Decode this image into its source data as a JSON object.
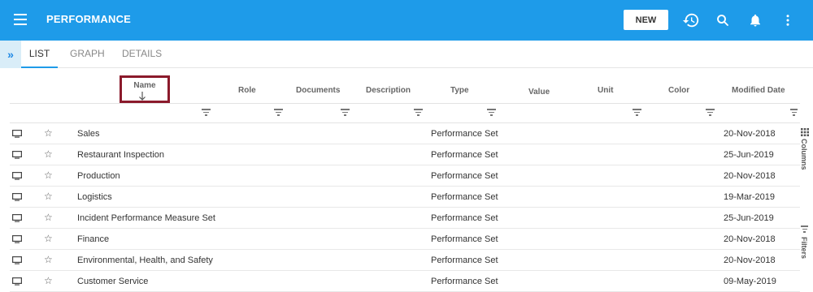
{
  "app": {
    "title": "PERFORMANCE",
    "new_label": "NEW"
  },
  "icons": {
    "menu": "hamburger-icon",
    "history": "history-icon",
    "search": "search-icon",
    "notifications": "bell-icon",
    "more": "more-vertical-icon",
    "expand": "double-chevron-right-icon",
    "row_view": "monitor-icon",
    "favorite": "star-outline-icon",
    "filter": "filter-icon",
    "sort": "arrow-down-icon",
    "columns": "grid-icon"
  },
  "tabs": [
    {
      "label": "LIST",
      "active": true
    },
    {
      "label": "GRAPH",
      "active": false
    },
    {
      "label": "DETAILS",
      "active": false
    }
  ],
  "columns": {
    "name": "Name",
    "role": "Role",
    "documents": "Documents",
    "description": "Description",
    "type": "Type",
    "value": "Value",
    "unit": "Unit",
    "color": "Color",
    "modified": "Modified Date"
  },
  "sort": {
    "column": "Name",
    "direction": "descending"
  },
  "rows": [
    {
      "name": "Sales",
      "type": "Performance Set",
      "modified": "20-Nov-2018"
    },
    {
      "name": "Restaurant Inspection",
      "type": "Performance Set",
      "modified": "25-Jun-2019"
    },
    {
      "name": "Production",
      "type": "Performance Set",
      "modified": "20-Nov-2018"
    },
    {
      "name": "Logistics",
      "type": "Performance Set",
      "modified": "19-Mar-2019"
    },
    {
      "name": "Incident Performance Measure Set",
      "type": "Performance Set",
      "modified": "25-Jun-2019"
    },
    {
      "name": "Finance",
      "type": "Performance Set",
      "modified": "20-Nov-2018"
    },
    {
      "name": "Environmental, Health, and Safety",
      "type": "Performance Set",
      "modified": "20-Nov-2018"
    },
    {
      "name": "Customer Service",
      "type": "Performance Set",
      "modified": "09-May-2019"
    }
  ],
  "side": {
    "columns_label": "Columns",
    "filters_label": "Filters"
  },
  "colors": {
    "topbar": "#1e9be9",
    "highlight_box": "#8b1a2b"
  }
}
